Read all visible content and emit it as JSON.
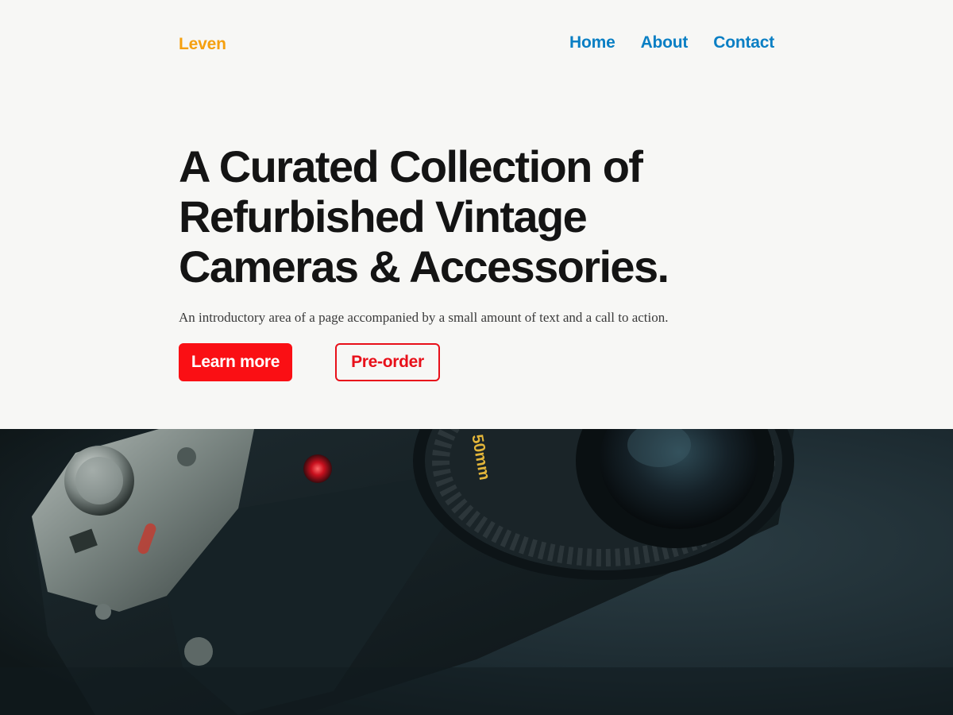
{
  "header": {
    "logo": "Leven",
    "nav": [
      {
        "label": "Home"
      },
      {
        "label": "About"
      },
      {
        "label": "Contact"
      }
    ]
  },
  "hero": {
    "title": "A Curated Collection of Refurbished Vintage Cameras & Accessories.",
    "subtitle": "An introductory area of a page accompanied by a small amount of text and a call to action.",
    "primary_button": "Learn more",
    "secondary_button": "Pre-order"
  },
  "photo": {
    "subject": "vintage-camera",
    "lens_text": "50mm"
  },
  "colors": {
    "background": "#f7f7f5",
    "logo": "#f5a00f",
    "nav_link": "#0a7fc4",
    "heading": "#141414",
    "accent_red": "#fa0f14"
  }
}
